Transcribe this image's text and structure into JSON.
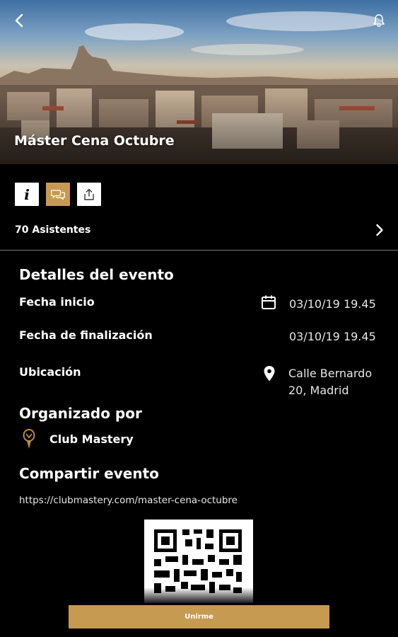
{
  "header": {
    "event_title": "Máster Cena Octubre",
    "back_icon": "chevron-left-icon",
    "notification_icon": "bell-icon"
  },
  "actions": [
    {
      "icon": "info-icon",
      "label": "i"
    },
    {
      "icon": "comments-icon"
    },
    {
      "icon": "share-icon"
    }
  ],
  "attendees": {
    "label": "70 Asistentes"
  },
  "details": {
    "title": "Detalles del evento",
    "start_label": "Fecha inicio",
    "start_value": "03/10/19 19.45",
    "end_label": "Fecha de finalización",
    "end_value": "03/10/19 19.45",
    "location_label": "Ubicación",
    "location_line1": "Calle Bernardo",
    "location_line2": "20, Madrid"
  },
  "organizer": {
    "title": "Organizado por",
    "name": "Club Mastery"
  },
  "share": {
    "title": "Compartir evento",
    "url": "https://clubmastery.com/master-cena-octubre"
  },
  "join_button": {
    "label": "Unirme"
  },
  "colors": {
    "accent": "#c79a52",
    "background": "#000000",
    "text": "#ffffff"
  }
}
